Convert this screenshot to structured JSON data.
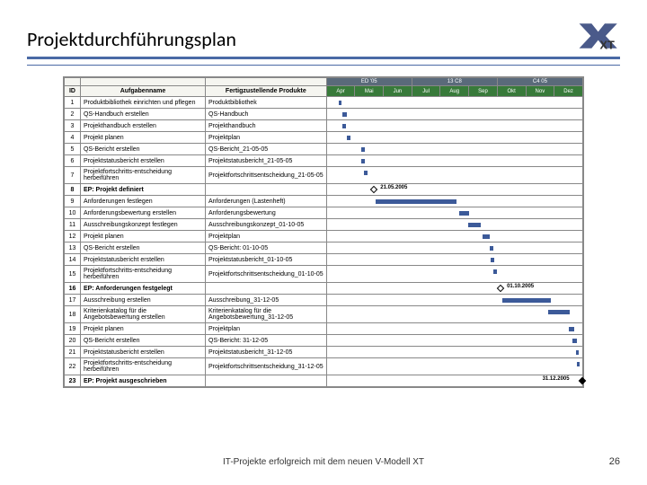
{
  "title": "Projektdurchführungsplan",
  "footer": "IT-Projekte erfolgreich mit dem neuen V-Modell XT",
  "page_num": "26",
  "logo_text": "XT",
  "columns": {
    "id": "ID",
    "task": "Aufgabenname",
    "product": "Fertigzustellende Produkte"
  },
  "sections": [
    "ED '05",
    "",
    "",
    "13 C8",
    "",
    "",
    "C4 05",
    "",
    ""
  ],
  "months": [
    "Apr",
    "Mai",
    "Jun",
    "Jul",
    "Aug",
    "Sep",
    "Okt",
    "Nov",
    "Dez"
  ],
  "rows": [
    {
      "id": "1",
      "task": "Produktbibliothek einrichten und pflegen",
      "product": "Produktbibliothek",
      "bars": [
        {
          "start": 0.4,
          "w": 0.12
        }
      ],
      "bold": false
    },
    {
      "id": "2",
      "task": "QS-Handbuch erstellen",
      "product": "QS-Handbuch",
      "bars": [
        {
          "start": 0.55,
          "w": 0.15
        }
      ],
      "bold": false
    },
    {
      "id": "3",
      "task": "Projekthandbuch erstellen",
      "product": "Projekthandbuch",
      "bars": [
        {
          "start": 0.55,
          "w": 0.12
        }
      ],
      "bold": false
    },
    {
      "id": "4",
      "task": "Projekt planen",
      "product": "Projektplan",
      "bars": [
        {
          "start": 0.7,
          "w": 0.12
        }
      ],
      "bold": false
    },
    {
      "id": "5",
      "task": "QS-Bericht erstellen",
      "product": "QS-Bericht_21-05-05",
      "bars": [
        {
          "start": 1.2,
          "w": 0.12
        }
      ],
      "bold": false
    },
    {
      "id": "6",
      "task": "Projektstatusbericht erstellen",
      "product": "Projektstatusbericht_21-05-05",
      "bars": [
        {
          "start": 1.2,
          "w": 0.12
        }
      ],
      "bold": false
    },
    {
      "id": "7",
      "task": "Projektfortschritts-entscheidung herbeiführen",
      "product": "Projektfortschrittsentscheidung_21-05-05",
      "bars": [
        {
          "start": 1.3,
          "w": 0.12
        }
      ],
      "bold": false
    },
    {
      "id": "8",
      "task": "EP: Projekt definiert",
      "product": "",
      "milestone": {
        "at": 1.55,
        "label": "21.05.2005",
        "filled": false
      },
      "bold": true
    },
    {
      "id": "9",
      "task": "Anforderungen festlegen",
      "product": "Anforderungen (Lastenheft)",
      "bars": [
        {
          "start": 1.7,
          "w": 2.8
        }
      ],
      "bold": false
    },
    {
      "id": "10",
      "task": "Anforderungsbewertung erstellen",
      "product": "Anforderungsbewertung",
      "bars": [
        {
          "start": 4.6,
          "w": 0.35
        }
      ],
      "bold": false
    },
    {
      "id": "11",
      "task": "Ausschreibungskonzept festlegen",
      "product": "Ausschreibungskonzept_01-10-05",
      "bars": [
        {
          "start": 4.9,
          "w": 0.45
        }
      ],
      "bold": false
    },
    {
      "id": "12",
      "task": "Projekt planen",
      "product": "Projektplan",
      "bars": [
        {
          "start": 5.4,
          "w": 0.25
        }
      ],
      "bold": false
    },
    {
      "id": "13",
      "task": "QS-Bericht erstellen",
      "product": "QS-Bericht: 01-10-05",
      "bars": [
        {
          "start": 5.65,
          "w": 0.15
        }
      ],
      "bold": false
    },
    {
      "id": "14",
      "task": "Projektstatusbericht erstellen",
      "product": "Projektstatusbericht_01-10-05",
      "bars": [
        {
          "start": 5.7,
          "w": 0.12
        }
      ],
      "bold": false
    },
    {
      "id": "15",
      "task": "Projektfortschritts-entscheidung herbeiführen",
      "product": "Projektfortschrittsentscheidung_01-10-05",
      "bars": [
        {
          "start": 5.8,
          "w": 0.12
        }
      ],
      "bold": false
    },
    {
      "id": "16",
      "task": "EP: Anforderungen festgelegt",
      "product": "",
      "milestone": {
        "at": 5.95,
        "label": "01.10.2005",
        "filled": false
      },
      "bold": true
    },
    {
      "id": "17",
      "task": "Ausschreibung erstellen",
      "product": "Ausschreibung_31-12-05",
      "bars": [
        {
          "start": 6.1,
          "w": 1.7
        }
      ],
      "bold": false
    },
    {
      "id": "18",
      "task": "Kriterienkatalog für die Angebotsbewertung erstellen",
      "product": "Kriterienkatalog für die Angebotsbewertung_31-12-05",
      "bars": [
        {
          "start": 7.7,
          "w": 0.75
        }
      ],
      "bold": false
    },
    {
      "id": "19",
      "task": "Projekt planen",
      "product": "Projektplan",
      "bars": [
        {
          "start": 8.4,
          "w": 0.2
        }
      ],
      "bold": false
    },
    {
      "id": "20",
      "task": "QS-Bericht erstellen",
      "product": "QS-Bericht: 31-12-05",
      "bars": [
        {
          "start": 8.55,
          "w": 0.15
        }
      ],
      "bold": false
    },
    {
      "id": "21",
      "task": "Projektstatusbericht erstellen",
      "product": "Projektstatusbericht_31-12-05",
      "bars": [
        {
          "start": 8.65,
          "w": 0.12
        }
      ],
      "bold": false
    },
    {
      "id": "22",
      "task": "Projektfortschritts-entscheidung herbeiführen",
      "product": "Projektfortschrittsentscheidung_31-12-05",
      "bars": [
        {
          "start": 8.7,
          "w": 0.1
        }
      ],
      "bold": false
    },
    {
      "id": "23",
      "task": "EP: Projekt ausgeschrieben",
      "product": "",
      "milestone": {
        "at": 8.8,
        "label": "31.12.2005",
        "filled": true
      },
      "bold": true
    }
  ]
}
